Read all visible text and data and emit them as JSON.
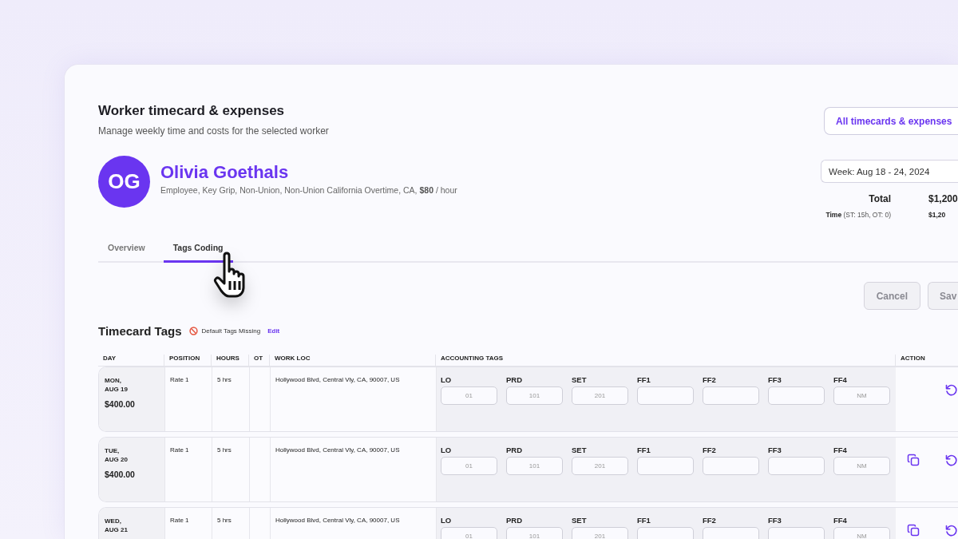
{
  "header": {
    "title": "Worker timecard & expenses",
    "subtitle": "Manage weekly time and costs for the selected worker"
  },
  "link_button": "All timecards & expenses",
  "worker": {
    "initials": "OG",
    "name": "Olivia Goethals",
    "details": "Employee, Key Grip, Non-Union, Non-Union California Overtime, CA, **$80** / hour"
  },
  "week_field": {
    "value": "Week: Aug 18 - 24, 2024"
  },
  "totals": [
    {
      "kind": "total",
      "label": "Total",
      "value": "$1,200"
    },
    {
      "kind": "sub",
      "label": "**Time** (ST: 15h, OT: 0)",
      "value": "$1,20"
    }
  ],
  "tabs": [
    {
      "label": "Overview",
      "selected": false
    },
    {
      "label": "Tags Coding",
      "selected": true
    }
  ],
  "buttons": [
    "Cancel",
    "Sav"
  ],
  "section": {
    "title": "Timecard Tags",
    "warning": "Default Tags Missing",
    "edit_link": "Edit"
  },
  "table": {
    "columns": [
      "DAY",
      "POSITION",
      "HOURS",
      "OT",
      "WORK LOC",
      "ACCOUNTING TAGS",
      "ACTION"
    ],
    "rows": [
      {
        "day": "MON,\nAUG 19",
        "amount": "$400.00",
        "position": "Rate 1",
        "hours": "5 hrs",
        "work_loc": "Hollywood Blvd, Central Vly, CA, 90007, US",
        "tags": [
          {
            "label": "LO",
            "placeholder": "01"
          },
          {
            "label": "PRD",
            "placeholder": "101"
          },
          {
            "label": "SET",
            "placeholder": "201"
          },
          {
            "label": "FF1"
          },
          {
            "label": "FF2"
          },
          {
            "label": "FF3"
          },
          {
            "label": "FF4",
            "placeholder": "NM"
          }
        ],
        "copy_action": false
      },
      {
        "day": "TUE,\nAUG 20",
        "amount": "$400.00",
        "position": "Rate 1",
        "hours": "5 hrs",
        "work_loc": "Hollywood Blvd, Central Vly, CA, 90007, US",
        "tags": [
          {
            "label": "LO",
            "placeholder": "01"
          },
          {
            "label": "PRD",
            "placeholder": "101"
          },
          {
            "label": "SET",
            "placeholder": "201"
          },
          {
            "label": "FF1"
          },
          {
            "label": "FF2"
          },
          {
            "label": "FF3"
          },
          {
            "label": "FF4",
            "placeholder": "NM"
          }
        ],
        "copy_action": true
      },
      {
        "day": "WED,\nAUG 21",
        "position": "Rate 1",
        "hours": "5 hrs",
        "work_loc": "Hollywood Blvd, Central Vly, CA, 90007, US",
        "tags": [
          {
            "label": "LO",
            "placeholder": "01"
          },
          {
            "label": "PRD",
            "placeholder": "101"
          },
          {
            "label": "SET",
            "placeholder": "201"
          },
          {
            "label": "FF1"
          },
          {
            "label": "FF2"
          },
          {
            "label": "FF3"
          },
          {
            "label": "FF4",
            "placeholder": "NM"
          }
        ],
        "copy_action": true
      }
    ]
  }
}
